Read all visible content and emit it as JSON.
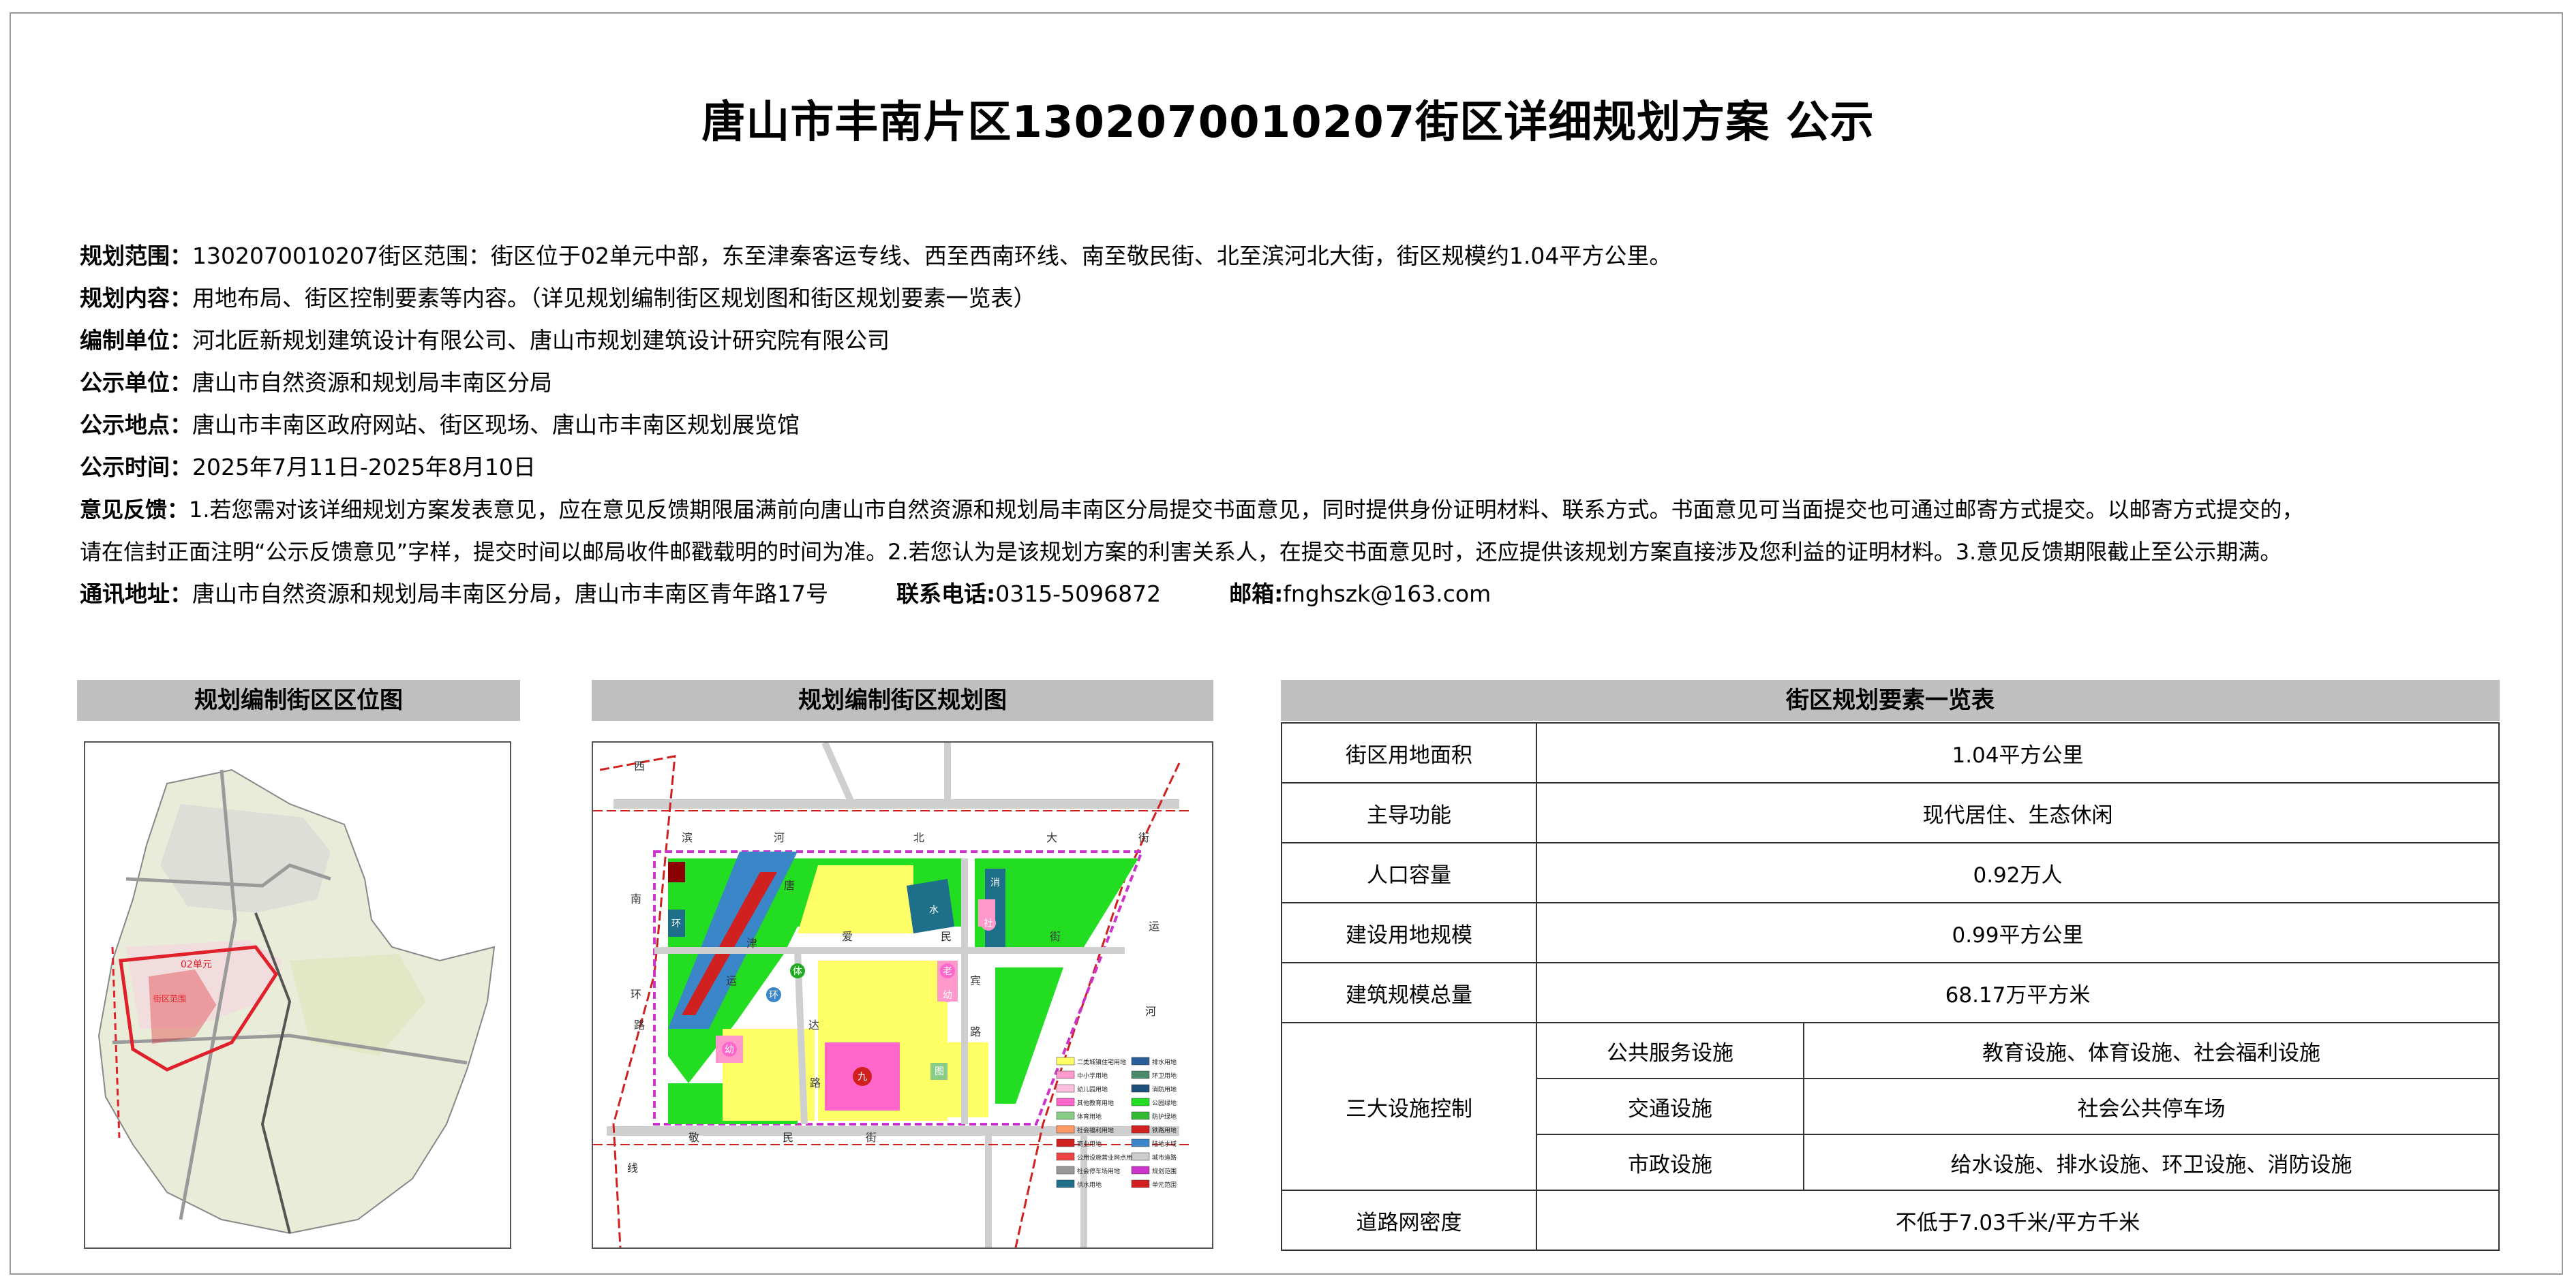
{
  "title": "唐山市丰南片区1302070010207街区详细规划方案 公示",
  "info": {
    "scope_label": "规划范围：",
    "scope_text": "1302070010207街区范围：街区位于02单元中部，东至津秦客运专线、西至西南环线、南至敬民街、北至滨河北大街，街区规模约1.04平方公里。",
    "content_label": "规划内容：",
    "content_text": "用地布局、街区控制要素等内容。（详见规划编制街区规划图和街区规划要素一览表）",
    "unit_label": "编制单位：",
    "unit_text": "河北匠新规划建筑设计有限公司、唐山市规划建筑设计研究院有限公司",
    "pub_unit_label": "公示单位：",
    "pub_unit_text": "唐山市自然资源和规划局丰南区分局",
    "place_label": "公示地点：",
    "place_text": "唐山市丰南区政府网站、街区现场、唐山市丰南区规划展览馆",
    "time_label": "公示时间：",
    "time_text": "2025年7月11日-2025年8月10日",
    "feedback_label": "意见反馈：",
    "feedback_text1": "1.若您需对该详细规划方案发表意见，应在意见反馈期限届满前向唐山市自然资源和规划局丰南区分局提交书面意见，同时提供身份证明材料、联系方式。书面意见可当面提交也可通过邮寄方式提交。以邮寄方式提交的，",
    "feedback_text2": "请在信封正面注明“公示反馈意见”字样，提交时间以邮局收件邮戳载明的时间为准。2.若您认为是该规划方案的利害关系人，在提交书面意见时，还应提供该规划方案直接涉及您利益的证明材料。3.意见反馈期限截止至公示期满。",
    "address_label": "通讯地址：",
    "address_text": "唐山市自然资源和规划局丰南区分局，唐山市丰南区青年路17号",
    "phone_label": "联系电话:",
    "phone_text": "0315-5096872",
    "email_label": "邮箱:",
    "email_text": "fnghszk@163.com"
  },
  "panels": {
    "location_title": "规划编制街区区位图",
    "plan_title": "规划编制街区规划图",
    "table_title": "街区规划要素一览表"
  },
  "location_map": {
    "labels": [
      "02单元",
      "街区范围"
    ],
    "colors": {
      "boundary": "#e0202a",
      "roads": "#9a9a9a",
      "land": "#e8ecd8"
    }
  },
  "plan_map": {
    "road_labels": [
      "西",
      "滨",
      "河",
      "北",
      "大",
      "街",
      "南",
      "环",
      "路",
      "线",
      "唐",
      "津",
      "运",
      "爱",
      "民",
      "街",
      "宾",
      "路",
      "达",
      "路",
      "敬",
      "民",
      "街",
      "运",
      "河"
    ],
    "facility_labels": [
      "九",
      "幼",
      "老",
      "环",
      "体",
      "水",
      "消",
      "社",
      "幼",
      "图",
      "环"
    ],
    "colors": {
      "residential": "#ffff66",
      "green": "#22dd22",
      "water": "#3a86c8",
      "commercial": "#ff66cc",
      "school": "#ff99cc",
      "utility": "#1d6f8a",
      "rail": "#d02020",
      "boundary": "#cc33cc"
    },
    "legend": [
      "二类城镇住宅用地",
      "中小学用地",
      "幼儿园用地",
      "其他教育用地",
      "体育用地",
      "社会福利用地",
      "商业用地",
      "公用设施营业网点用地",
      "社会停车场用地",
      "供水用地",
      "排水用地",
      "环卫用地",
      "消防用地",
      "公园绿地",
      "防护绿地",
      "铁路用地",
      "陆地水域",
      "城市道路",
      "规划范围",
      "单元范围"
    ]
  },
  "requirements": {
    "rows": [
      {
        "key": "街区用地面积",
        "value": "1.04平方公里"
      },
      {
        "key": "主导功能",
        "value": "现代居住、生态休闲"
      },
      {
        "key": "人口容量",
        "value": "0.92万人"
      },
      {
        "key": "建设用地规模",
        "value": "0.99平方公里"
      },
      {
        "key": "建筑规模总量",
        "value": "68.17万平方米"
      }
    ],
    "facility_key": "三大设施控制",
    "facilities": [
      {
        "sub": "公共服务设施",
        "value": "教育设施、体育设施、社会福利设施"
      },
      {
        "sub": "交通设施",
        "value": "社会公共停车场"
      },
      {
        "sub": "市政设施",
        "value": "给水设施、排水设施、环卫设施、消防设施"
      }
    ],
    "density_key": "道路网密度",
    "density_value": "不低于7.03千米/平方千米"
  }
}
